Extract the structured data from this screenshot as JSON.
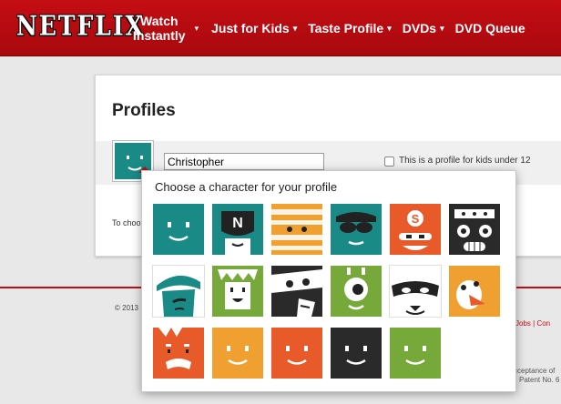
{
  "header": {
    "logo": "NETFLIX",
    "nav": [
      {
        "line1": "Watch",
        "line2": "Instantly"
      },
      {
        "label": "Just for Kids"
      },
      {
        "label": "Taste Profile"
      },
      {
        "label": "DVDs"
      },
      {
        "label": "DVD Queue"
      }
    ],
    "caret": "▾"
  },
  "profiles": {
    "title": "Profiles",
    "name_value": "Christopher",
    "kids_label": "This is a profile for kids under 12",
    "choose_hint": "To choo"
  },
  "popup": {
    "title": "Choose a character for your profile",
    "characters": [
      {
        "name": "teal-smile",
        "bg": "#1a8a87"
      },
      {
        "name": "n-hero",
        "bg": "#1a8a87"
      },
      {
        "name": "mummy",
        "bg": "#f0a030"
      },
      {
        "name": "aviator",
        "bg": "#1a8a87"
      },
      {
        "name": "s-hero",
        "bg": "#e85a2a"
      },
      {
        "name": "robot",
        "bg": "#2a2a2a"
      },
      {
        "name": "hat-lady",
        "bg": "#ffffff"
      },
      {
        "name": "green-kid",
        "bg": "#76a83a"
      },
      {
        "name": "bandit",
        "bg": "#2a2a2a"
      },
      {
        "name": "cyclops",
        "bg": "#76a83a"
      },
      {
        "name": "masked-dog",
        "bg": "#ffffff"
      },
      {
        "name": "penguin",
        "bg": "#f0a030"
      },
      {
        "name": "red-grump",
        "bg": "#e85a2a"
      },
      {
        "name": "orange-smile",
        "bg": "#f0a030"
      },
      {
        "name": "red-smile",
        "bg": "#e85a2a"
      },
      {
        "name": "black-smile",
        "bg": "#2a2a2a"
      },
      {
        "name": "green-smile",
        "bg": "#76a83a"
      }
    ]
  },
  "footer": {
    "copyright": "© 2013",
    "links": "Jobs  |  Con",
    "legal1": "cceptance of",
    "legal2": "Patent No. 6"
  }
}
